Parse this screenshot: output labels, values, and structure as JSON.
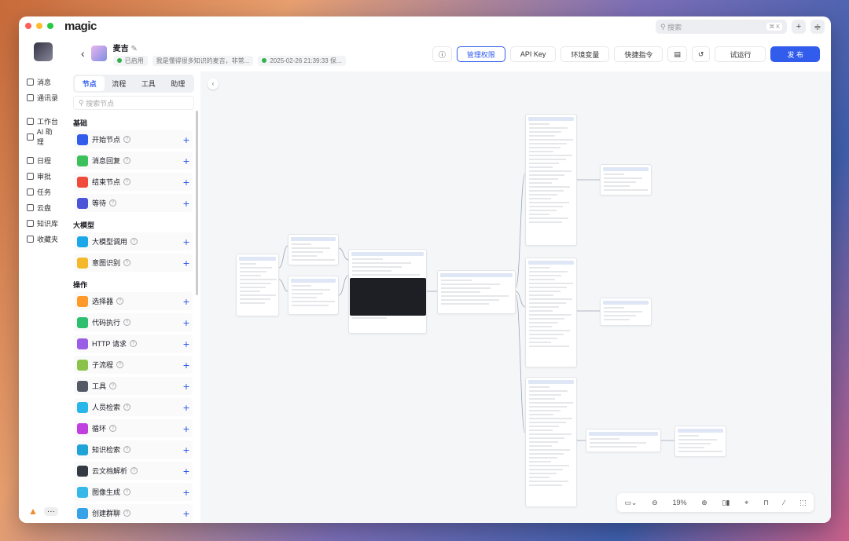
{
  "app": {
    "logo": "magic",
    "search_placeholder": "搜索",
    "search_shortcut": "⌘ K"
  },
  "nav": {
    "items": [
      {
        "label": "消息"
      },
      {
        "label": "通讯录"
      },
      {
        "label": "工作台"
      },
      {
        "label": "AI 助理"
      },
      {
        "label": "日程"
      },
      {
        "label": "审批"
      },
      {
        "label": "任务"
      },
      {
        "label": "云盘"
      },
      {
        "label": "知识库"
      },
      {
        "label": "收藏夹"
      }
    ],
    "more": "···"
  },
  "header": {
    "name": "麦吉",
    "status": "已启用",
    "description": "我是懂得很多知识的麦吉，非常...",
    "saved": "2025-02-26 21:39:33 保...",
    "buttons": {
      "permissions": "管理权限",
      "api_key": "API Key",
      "env": "环境变量",
      "shortcuts": "快捷指令",
      "test_run": "试运行",
      "publish": "发 布"
    }
  },
  "panel": {
    "tabs": [
      "节点",
      "流程",
      "工具",
      "助理"
    ],
    "search_placeholder": "搜索节点",
    "groups": [
      {
        "title": "基础",
        "items": [
          {
            "label": "开始节点",
            "color": "#315cec"
          },
          {
            "label": "消息回复",
            "color": "#3cc15a"
          },
          {
            "label": "结束节点",
            "color": "#f04a3a"
          },
          {
            "label": "等待",
            "color": "#4a55d8"
          }
        ]
      },
      {
        "title": "大模型",
        "items": [
          {
            "label": "大模型调用",
            "color": "#1ca8e8"
          },
          {
            "label": "意图识别",
            "color": "#f5b82a"
          }
        ]
      },
      {
        "title": "操作",
        "items": [
          {
            "label": "选择器",
            "color": "#ff9a2a"
          },
          {
            "label": "代码执行",
            "color": "#2cbf6e"
          },
          {
            "label": "HTTP 请求",
            "color": "#9b5de5"
          },
          {
            "label": "子流程",
            "color": "#8bc34a"
          },
          {
            "label": "工具",
            "color": "#555b66"
          },
          {
            "label": "人员检索",
            "color": "#29b6e8"
          },
          {
            "label": "循环",
            "color": "#c13ee0"
          },
          {
            "label": "知识检索",
            "color": "#1fa4d8"
          },
          {
            "label": "云文档解析",
            "color": "#333a44"
          },
          {
            "label": "图像生成",
            "color": "#36b8e8"
          },
          {
            "label": "创建群聊",
            "color": "#36a3e8"
          }
        ]
      }
    ]
  },
  "zoom": {
    "level": "19%"
  }
}
